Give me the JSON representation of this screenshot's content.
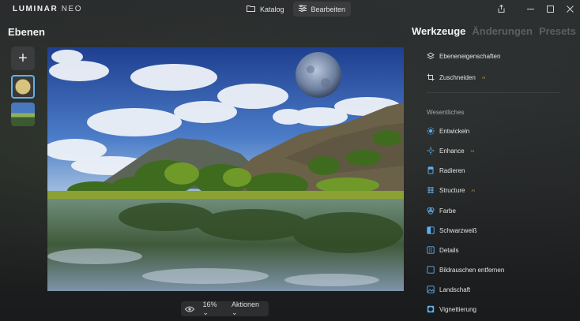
{
  "app": {
    "logo_main": "LUMINAR",
    "logo_suffix": "NEO"
  },
  "mode_tabs": [
    {
      "label": "Katalog",
      "icon": "folder-icon",
      "active": false
    },
    {
      "label": "Bearbeiten",
      "icon": "sliders-icon",
      "active": true
    }
  ],
  "window_controls": [
    "share-icon",
    "minimize-icon",
    "maximize-icon",
    "close-icon"
  ],
  "layers_panel": {
    "title": "Ebenen",
    "add_label": "+"
  },
  "bottom_bar": {
    "zoom": "16%",
    "actions_label": "Aktionen"
  },
  "right_tabs": [
    {
      "label": "Werkzeuge",
      "active": true
    },
    {
      "label": "Änderungen",
      "active": false
    },
    {
      "label": "Presets",
      "active": false
    }
  ],
  "top_tools": [
    {
      "label": "Ebeneneigenschaften",
      "icon": "layers-icon",
      "ai": false
    },
    {
      "label": "Zuschneiden",
      "icon": "crop-icon",
      "ai": true
    }
  ],
  "section_label": "Wesentliches",
  "essential_tools": [
    {
      "label": "Entwickeln",
      "icon": "sun-icon",
      "ai": false
    },
    {
      "label": "Enhance",
      "icon": "sparkle-icon",
      "ai": true
    },
    {
      "label": "Radieren",
      "icon": "eraser-icon",
      "ai": false
    },
    {
      "label": "Structure",
      "icon": "structure-icon",
      "ai": true
    },
    {
      "label": "Farbe",
      "icon": "palette-icon",
      "ai": false
    },
    {
      "label": "Schwarzweiß",
      "icon": "bw-icon",
      "ai": false
    },
    {
      "label": "Details",
      "icon": "details-icon",
      "ai": false
    },
    {
      "label": "Bildrauschen entfernen",
      "icon": "denoise-icon",
      "ai": false
    },
    {
      "label": "Landschaft",
      "icon": "landscape-icon",
      "ai": false
    },
    {
      "label": "Vignettierung",
      "icon": "vignette-icon",
      "ai": false
    }
  ],
  "ai_badge": "AI",
  "colors": {
    "accent": "#5fb0f0",
    "ai_badge": "#c8a24a",
    "background": "#1c1d1f"
  }
}
